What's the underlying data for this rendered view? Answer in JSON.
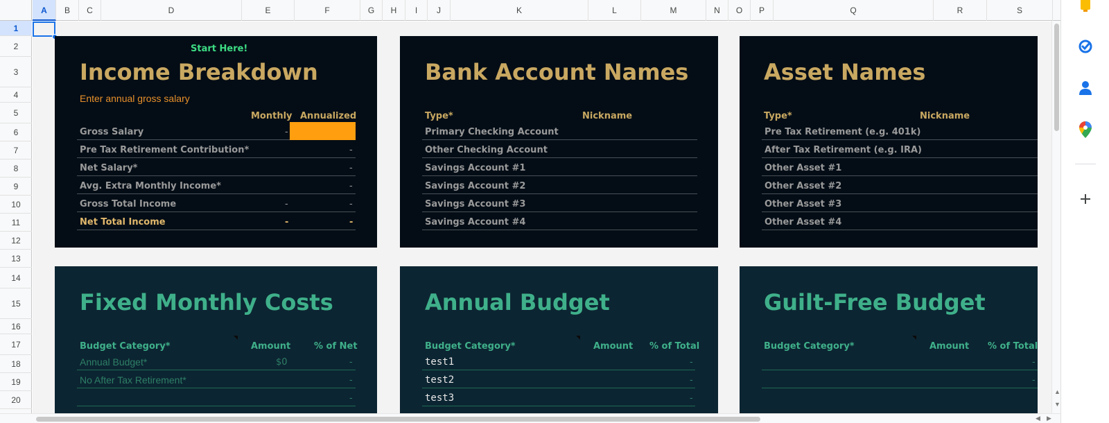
{
  "columns": [
    {
      "label": "A",
      "w": 34,
      "selected": true
    },
    {
      "label": "B",
      "w": 33
    },
    {
      "label": "C",
      "w": 32
    },
    {
      "label": "D",
      "w": 203
    },
    {
      "label": "E",
      "w": 76
    },
    {
      "label": "F",
      "w": 95
    },
    {
      "label": "G",
      "w": 32
    },
    {
      "label": "H",
      "w": 33
    },
    {
      "label": "I",
      "w": 32
    },
    {
      "label": "J",
      "w": 33
    },
    {
      "label": "K",
      "w": 199
    },
    {
      "label": "L",
      "w": 76
    },
    {
      "label": "M",
      "w": 94
    },
    {
      "label": "N",
      "w": 32
    },
    {
      "label": "O",
      "w": 32
    },
    {
      "label": "P",
      "w": 33
    },
    {
      "label": "Q",
      "w": 231
    },
    {
      "label": "R",
      "w": 77
    },
    {
      "label": "S",
      "w": 95
    }
  ],
  "rows": [
    {
      "label": "1",
      "h": 22,
      "selected": true
    },
    {
      "label": "2",
      "h": 30
    },
    {
      "label": "3",
      "h": 44
    },
    {
      "label": "4",
      "h": 22
    },
    {
      "label": "5",
      "h": 30
    },
    {
      "label": "6",
      "h": 26
    },
    {
      "label": "7",
      "h": 26
    },
    {
      "label": "8",
      "h": 26
    },
    {
      "label": "9",
      "h": 26
    },
    {
      "label": "10",
      "h": 26
    },
    {
      "label": "11",
      "h": 26
    },
    {
      "label": "12",
      "h": 26
    },
    {
      "label": "13",
      "h": 26
    },
    {
      "label": "14",
      "h": 30
    },
    {
      "label": "15",
      "h": 44
    },
    {
      "label": "16",
      "h": 22
    },
    {
      "label": "17",
      "h": 30
    },
    {
      "label": "18",
      "h": 26
    },
    {
      "label": "19",
      "h": 26
    },
    {
      "label": "20",
      "h": 26
    }
  ],
  "income": {
    "start_here": "Start Here!",
    "title": "Income Breakdown",
    "subtitle": "Enter annual gross salary",
    "col_monthly": "Monthly",
    "col_annualized": "Annualized",
    "rows": [
      {
        "label": "Gross Salary",
        "monthly": "-",
        "annualized": ""
      },
      {
        "label": "Pre Tax Retirement Contribution*",
        "monthly": "",
        "annualized": "-"
      },
      {
        "label": "Net Salary*",
        "monthly": "",
        "annualized": "-"
      },
      {
        "label": "Avg. Extra Monthly Income*",
        "monthly": "",
        "annualized": "-"
      },
      {
        "label": "Gross Total Income",
        "monthly": "-",
        "annualized": "-"
      },
      {
        "label": "Net Total Income",
        "monthly": "-",
        "annualized": "-"
      }
    ]
  },
  "bank": {
    "title": "Bank Account Names",
    "col_type": "Type*",
    "col_nickname": "Nickname",
    "rows": [
      "Primary Checking Account",
      "Other Checking Account",
      "Savings Account #1",
      "Savings Account #2",
      "Savings Account #3",
      "Savings Account #4"
    ]
  },
  "asset": {
    "title": "Asset Names",
    "col_type": "Type*",
    "col_nickname": "Nickname",
    "rows": [
      "Pre Tax Retirement (e.g. 401k)",
      "After Tax Retirement (e.g. IRA)",
      "Other Asset #1",
      "Other Asset #2",
      "Other Asset #3",
      "Other Asset #4"
    ]
  },
  "fixed": {
    "title": "Fixed Monthly Costs",
    "col_category": "Budget Category*",
    "col_amount": "Amount",
    "col_pct": "% of Net",
    "rows": [
      {
        "label": "Annual Budget*",
        "amount": "$0",
        "pct": "-"
      },
      {
        "label": "No After Tax Retirement*",
        "amount": "",
        "pct": "-"
      },
      {
        "label": "",
        "amount": "",
        "pct": "-"
      }
    ]
  },
  "annual": {
    "title": "Annual Budget",
    "col_category": "Budget Category*",
    "col_amount": "Amount",
    "col_pct": "% of Total",
    "rows": [
      {
        "label": "test1",
        "pct": "-"
      },
      {
        "label": "test2",
        "pct": "-"
      },
      {
        "label": "test3",
        "pct": "-"
      }
    ]
  },
  "guilt": {
    "title": "Guilt-Free Budget",
    "col_category": "Budget Category*",
    "col_amount": "Amount",
    "col_pct": "% of Total",
    "rows": [
      {
        "label": "",
        "pct": "-"
      },
      {
        "label": "",
        "pct": "-"
      }
    ]
  },
  "side_panel": {
    "icons": [
      "keep-icon",
      "tasks-icon",
      "contacts-icon",
      "maps-icon",
      "add-icon"
    ]
  }
}
